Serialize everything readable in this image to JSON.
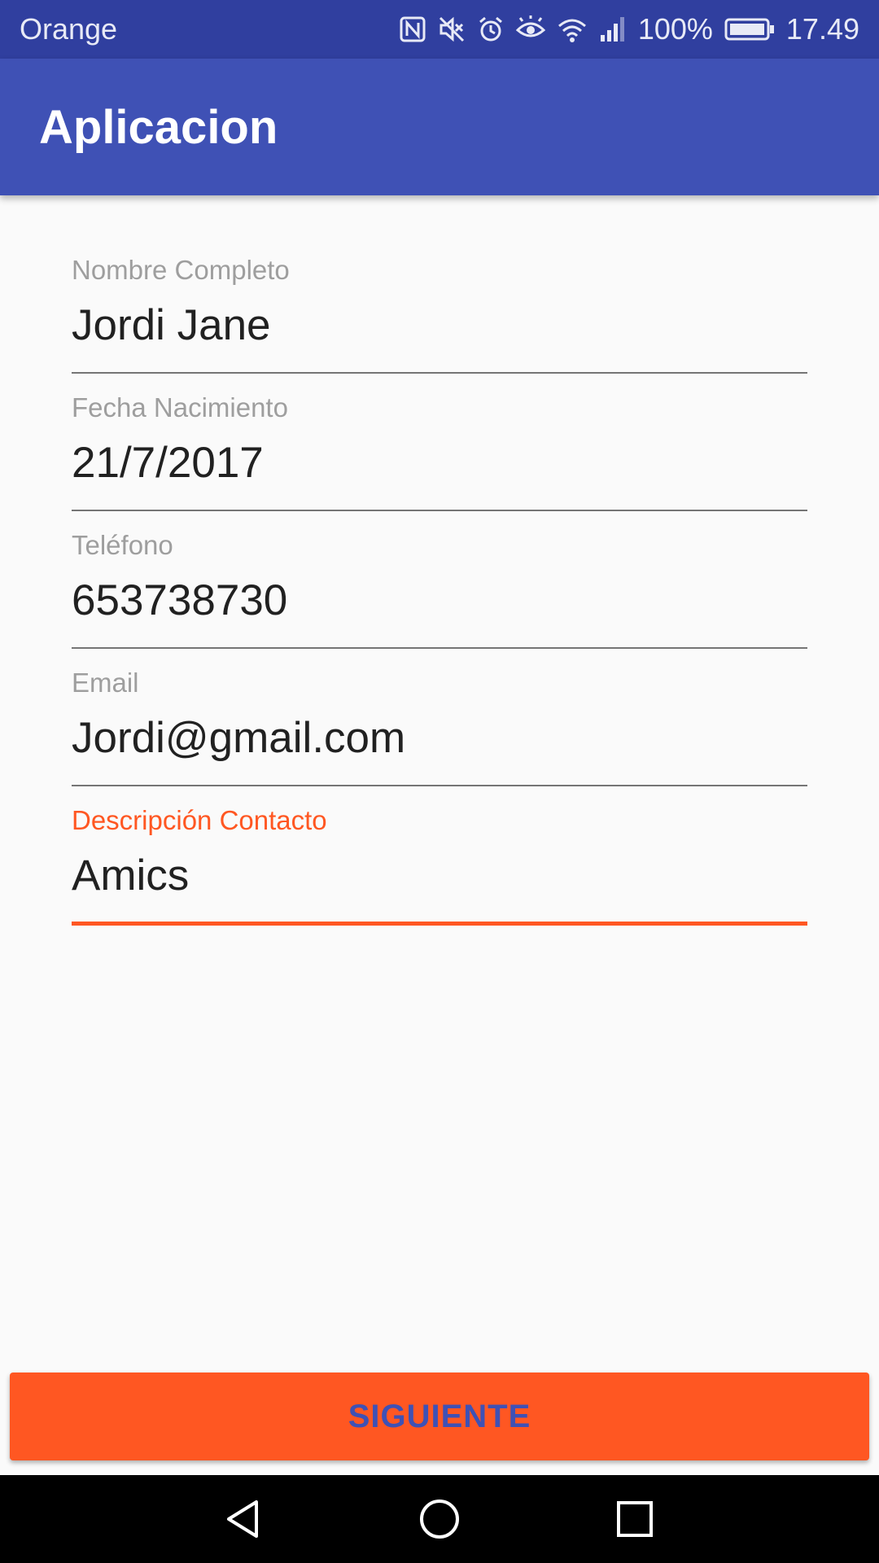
{
  "status_bar": {
    "carrier": "Orange",
    "battery_percent": "100%",
    "time": "17.49",
    "icons": [
      "nfc-icon",
      "mute-icon",
      "alarm-icon",
      "eye-comfort-icon",
      "wifi-icon",
      "signal-icon",
      "battery-icon"
    ]
  },
  "app_bar": {
    "title": "Aplicacion"
  },
  "form": {
    "fields": [
      {
        "label": "Nombre Completo",
        "value": "Jordi Jane"
      },
      {
        "label": "Fecha Nacimiento",
        "value": "21/7/2017"
      },
      {
        "label": "Teléfono",
        "value": "653738730"
      },
      {
        "label": "Email",
        "value": "Jordi@gmail.com"
      },
      {
        "label": "Descripción Contacto",
        "value": "Amics"
      }
    ]
  },
  "actions": {
    "next_label": "SIGUIENTE"
  },
  "nav_bar": {
    "icons": [
      "back-icon",
      "home-icon",
      "recents-icon"
    ]
  },
  "colors": {
    "status_bar": "#303f9f",
    "primary": "#3f51b5",
    "accent": "#ff5722",
    "background": "#fafafa"
  }
}
